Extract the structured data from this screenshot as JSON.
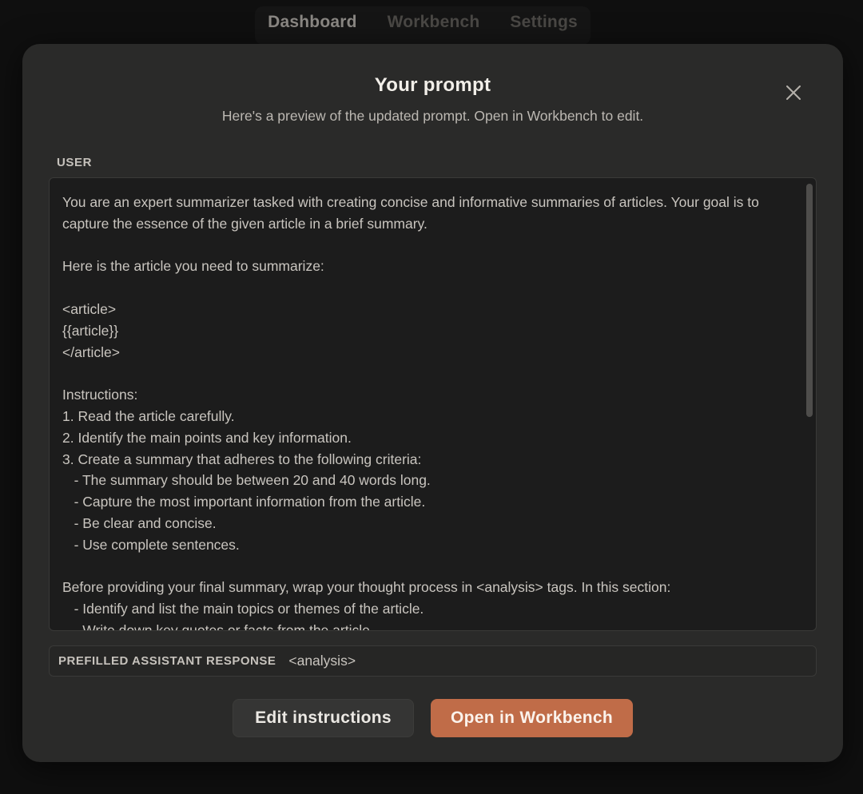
{
  "nav": {
    "tabs": [
      {
        "label": "Dashboard",
        "active": true
      },
      {
        "label": "Workbench",
        "active": false
      },
      {
        "label": "Settings",
        "active": false
      }
    ]
  },
  "modal": {
    "title": "Your prompt",
    "subtitle": "Here's a preview of the updated prompt. Open in Workbench to edit.",
    "close_icon": "close-icon",
    "user_label": "USER",
    "prompt_text": "You are an expert summarizer tasked with creating concise and informative summaries of articles. Your goal is to capture the essence of the given article in a brief summary.\n\nHere is the article you need to summarize:\n\n<article>\n{{article}}\n</article>\n\nInstructions:\n1. Read the article carefully.\n2. Identify the main points and key information.\n3. Create a summary that adheres to the following criteria:\n   - The summary should be between 20 and 40 words long.\n   - Capture the most important information from the article.\n   - Be clear and concise.\n   - Use complete sentences.\n\nBefore providing your final summary, wrap your thought process in <analysis> tags. In this section:\n   - Identify and list the main topics or themes of the article.\n   - Write down key quotes or facts from the article.",
    "prefill_label": "PREFILLED ASSISTANT RESPONSE",
    "prefill_value": "<analysis>",
    "edit_button": "Edit instructions",
    "open_button": "Open in Workbench"
  },
  "colors": {
    "modal_bg": "#2a2a29",
    "accent": "#c06c48"
  }
}
